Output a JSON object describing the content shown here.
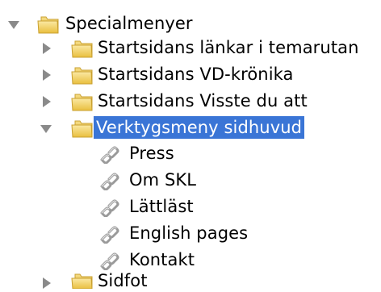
{
  "tree": {
    "root": {
      "label": "Specialmenyer",
      "expanded": true,
      "icon": "folder-icon"
    },
    "children": [
      {
        "label": "Startsidans länkar i temarutan",
        "expanded": false,
        "icon": "folder-icon"
      },
      {
        "label": "Startsidans VD-krönika",
        "expanded": false,
        "icon": "folder-icon"
      },
      {
        "label": "Startsidans Visste du att",
        "expanded": false,
        "icon": "folder-icon"
      },
      {
        "label": "Verktygsmeny sidhuvud",
        "expanded": true,
        "selected": true,
        "icon": "folder-icon",
        "links": [
          {
            "label": "Press",
            "icon": "link-icon"
          },
          {
            "label": "Om SKL",
            "icon": "link-icon"
          },
          {
            "label": "Lättläst",
            "icon": "link-icon"
          },
          {
            "label": "English pages",
            "icon": "link-icon"
          },
          {
            "label": "Kontakt",
            "icon": "link-icon"
          }
        ]
      },
      {
        "label": "Sidfot",
        "expanded": false,
        "icon": "folder-icon"
      }
    ]
  },
  "colors": {
    "selection": "#3a75d6",
    "disclosure": "#8a8a8a",
    "folder": "#f3d36b",
    "link_icon": "#9a9a9a"
  }
}
